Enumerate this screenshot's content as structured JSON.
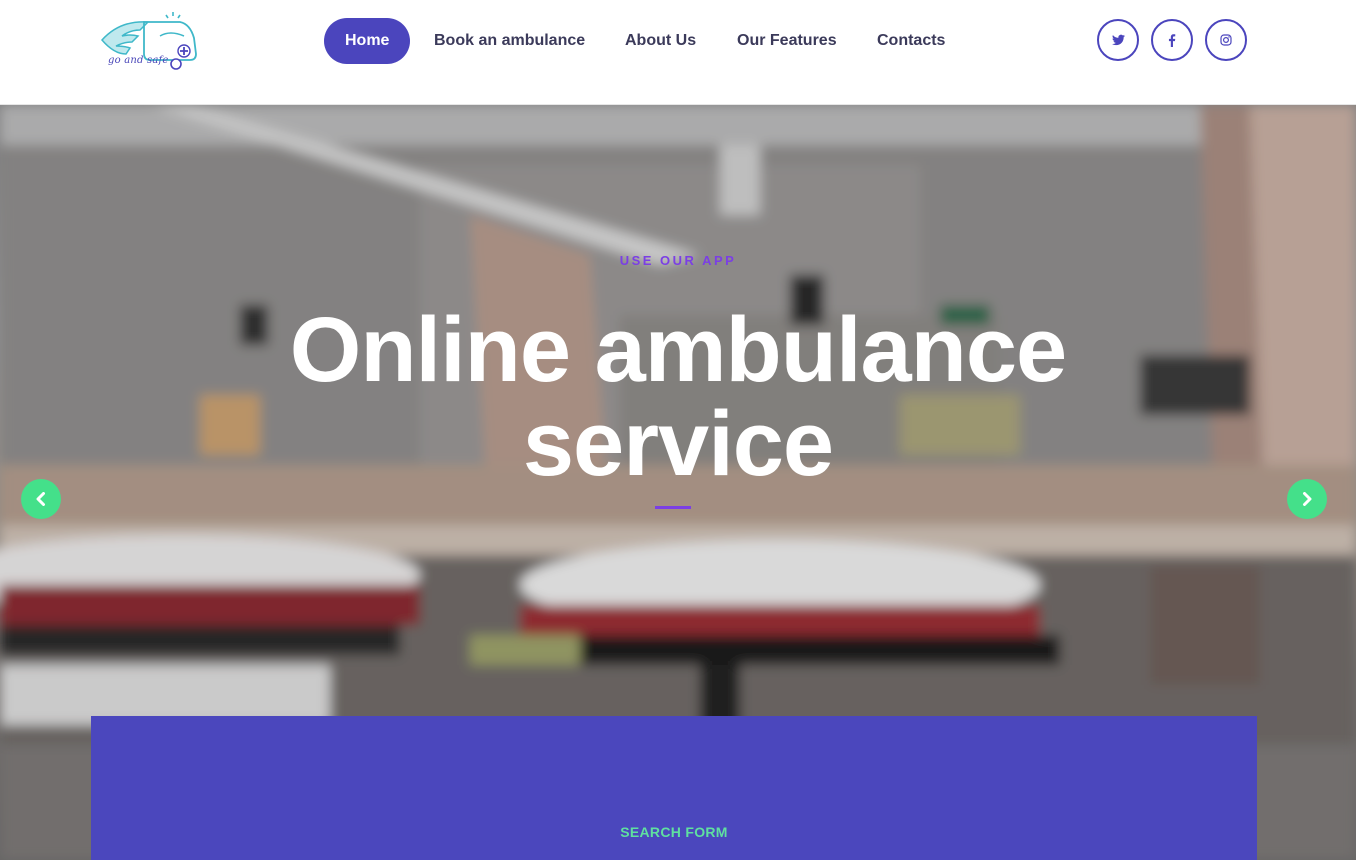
{
  "brand": {
    "logo_text": "go and safe",
    "logo_icon": "winged-ambulance-icon"
  },
  "nav": {
    "items": [
      {
        "label": "Home",
        "active": true
      },
      {
        "label": "Book an ambulance",
        "active": false
      },
      {
        "label": "About Us",
        "active": false
      },
      {
        "label": "Our Features",
        "active": false
      },
      {
        "label": "Contacts",
        "active": false
      }
    ]
  },
  "social": [
    {
      "icon": "twitter-icon"
    },
    {
      "icon": "facebook-icon"
    },
    {
      "icon": "instagram-icon"
    }
  ],
  "hero": {
    "kicker": "USE OUR APP",
    "title_line1": "Online ambulance",
    "title_line2": "service",
    "prev_icon": "chevron-left-icon",
    "next_icon": "chevron-right-icon"
  },
  "search": {
    "label": "SEARCH FORM"
  },
  "colors": {
    "primary": "#4b45bd",
    "accent_purple": "#7b3fe4",
    "accent_green": "#44e08a",
    "search_label": "#5fe0a0"
  }
}
